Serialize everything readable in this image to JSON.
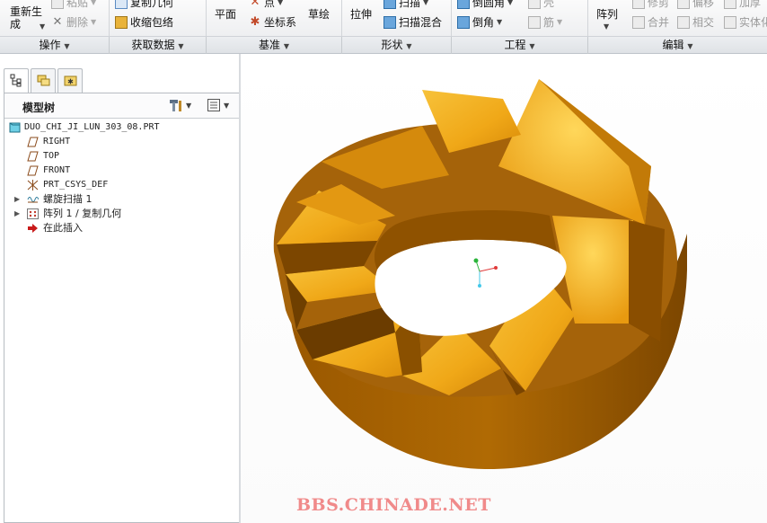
{
  "ribbon": {
    "regenerate_label": "重新生\n成",
    "paste_label": "粘贴",
    "delete_label": "删除",
    "copy_geometry_label": "复制几何",
    "shrinkwrap_label": "收缩包络",
    "plane_label": "平面",
    "point_label": "点",
    "csys_label": "坐标系",
    "sketch_label": "草绘",
    "extrude_label": "拉伸",
    "sweep_label": "扫描",
    "swept_blend_label": "扫描混合",
    "round_label": "倒圆角",
    "chamfer_label": "倒角",
    "shell_label": "壳",
    "rib_label": "筋",
    "pattern_label": "阵列",
    "trim_label": "修剪",
    "offset_label": "偏移",
    "thicken_label": "加厚",
    "merge_label": "合并",
    "intersect_label": "相交",
    "solidify_label": "实体化"
  },
  "groups": {
    "operations": "操作",
    "get_data": "获取数据",
    "datum": "基准",
    "shapes": "形状",
    "engineering": "工程",
    "editing": "编辑"
  },
  "model_tree": {
    "title": "模型树",
    "items": [
      {
        "label": "DUO_CHI_JI_LUN_303_08.PRT"
      },
      {
        "label": "RIGHT"
      },
      {
        "label": "TOP"
      },
      {
        "label": "FRONT"
      },
      {
        "label": "PRT_CSYS_DEF"
      },
      {
        "label": "螺旋扫描 1"
      },
      {
        "label": "阵列 1 / 复制几何"
      },
      {
        "label": "在此插入"
      }
    ]
  },
  "watermark": "BBS.CHINADE.NET",
  "colors": {
    "model_light": "#f3b01f",
    "model_mid": "#d78a0c",
    "model_dark": "#8a4f00",
    "watermark": "#f08a8a",
    "accent": "#2d6ea8"
  }
}
